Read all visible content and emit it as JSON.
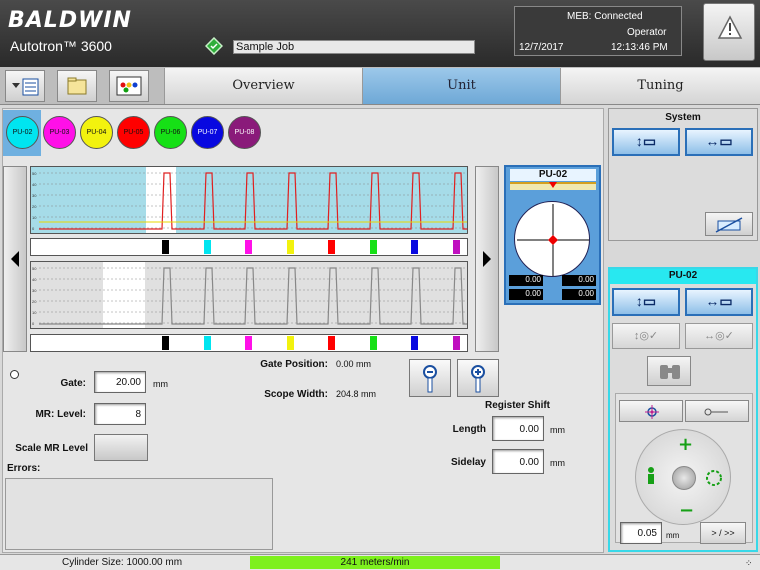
{
  "header": {
    "brand": "BALDWIN",
    "product": "Autotron™ 3600",
    "job_name": "Sample Job",
    "status": "MEB:  Connected",
    "role": "Operator",
    "date": "12/7/2017",
    "time": "12:13:46 PM"
  },
  "tabs": [
    "Overview",
    "Unit",
    "Tuning"
  ],
  "active_tab": "Unit",
  "units": [
    {
      "label": "PU-02",
      "color": "#00e5f0"
    },
    {
      "label": "PU-03",
      "color": "#ff10e8"
    },
    {
      "label": "PU-04",
      "color": "#f2f20e"
    },
    {
      "label": "PU-05",
      "color": "#ff0000"
    },
    {
      "label": "PU-06",
      "color": "#16e016"
    },
    {
      "label": "PU-07",
      "color": "#0808e0"
    },
    {
      "label": "PU-08",
      "color": "#8a1a7a"
    }
  ],
  "register_view": {
    "title": "PU-02",
    "readouts": [
      "0.00",
      "0.00",
      "0.00",
      "0.00"
    ]
  },
  "gate_position": {
    "label": "Gate Position:",
    "value": "0.00 mm"
  },
  "scope_width": {
    "label": "Scope Width:",
    "value": "204.8 mm"
  },
  "gate": {
    "label": "Gate:",
    "value": "20.00",
    "unit": "mm"
  },
  "mr_level": {
    "label": "MR:  Level:",
    "value": "8"
  },
  "scale_mr_level": {
    "label": "Scale MR Level"
  },
  "register_shift": {
    "title": "Register Shift",
    "length": {
      "label": "Length",
      "value": "0.00",
      "unit": "mm"
    },
    "sidelay": {
      "label": "Sidelay",
      "value": "0.00",
      "unit": "mm"
    }
  },
  "errors": {
    "label": "Errors:"
  },
  "system_panel": {
    "title": "System"
  },
  "unit_panel": {
    "title": "PU-02",
    "step_value": "0.05",
    "step_unit": "mm",
    "step_button": "> / >>"
  },
  "footer": {
    "cylinder": "Cylinder Size: 1000.00 mm",
    "speed": "241 meters/min"
  },
  "scope_axis_ticks": [
    "50",
    "40",
    "30",
    "20",
    "10",
    "0"
  ],
  "strip_marks": [
    {
      "color": "#000000"
    },
    {
      "color": "#00e5f0"
    },
    {
      "color": "#ff10e8"
    },
    {
      "color": "#f2f20e"
    },
    {
      "color": "#ff0000"
    },
    {
      "color": "#16e016"
    },
    {
      "color": "#0808e0"
    },
    {
      "color": "#c010c0"
    }
  ]
}
